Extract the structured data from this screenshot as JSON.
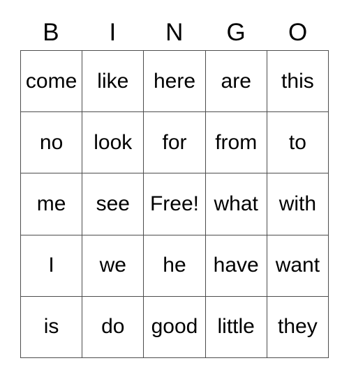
{
  "card": {
    "title": "BINGO",
    "header_letters": [
      "B",
      "I",
      "N",
      "G",
      "O"
    ],
    "rows": [
      [
        "come",
        "like",
        "here",
        "are",
        "this"
      ],
      [
        "no",
        "look",
        "for",
        "from",
        "to"
      ],
      [
        "me",
        "see",
        "Free!",
        "what",
        "with"
      ],
      [
        "I",
        "we",
        "he",
        "have",
        "want"
      ],
      [
        "is",
        "do",
        "good",
        "little",
        "they"
      ]
    ],
    "free_space": {
      "label": "Free!",
      "row": 2,
      "col": 2
    },
    "colors": {
      "background": "#ffffff",
      "text": "#000000",
      "grid_line": "#4d4d4d"
    }
  }
}
